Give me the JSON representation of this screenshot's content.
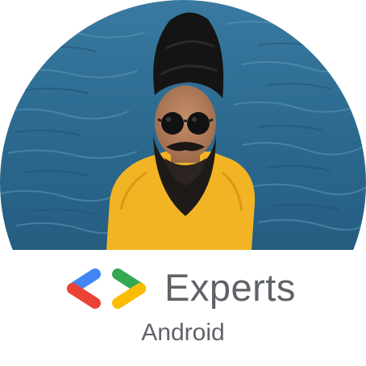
{
  "badge": {
    "program_label": "Experts",
    "track_label": "Android"
  },
  "icons": {
    "logo": "gde-chevron-logo-icon"
  },
  "colors": {
    "logo_blue": "#4285F4",
    "logo_red": "#EA4335",
    "logo_green": "#34A853",
    "logo_yellow": "#FBBC04",
    "text_gray": "#5f6368",
    "water": "#2f6f95",
    "shirt": "#f2b424"
  }
}
